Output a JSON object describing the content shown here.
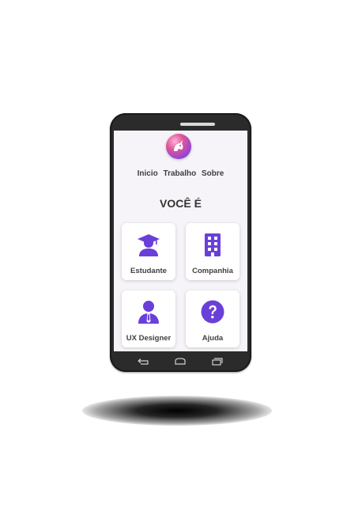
{
  "nav": {
    "items": [
      "Inicio",
      "Trabalho",
      "Sobre"
    ]
  },
  "heading": "VOCÊ É",
  "cards": [
    {
      "label": "Estudante",
      "icon": "graduate-icon"
    },
    {
      "label": "Companhia",
      "icon": "building-icon"
    },
    {
      "label": "UX Designer",
      "icon": "user-tie-icon"
    },
    {
      "label": "Ajuda",
      "icon": "question-circle-icon"
    }
  ],
  "colors": {
    "accent": "#6a3fd8",
    "phone_body": "#2b2b2b",
    "screen_bg": "#f6f4f8"
  }
}
